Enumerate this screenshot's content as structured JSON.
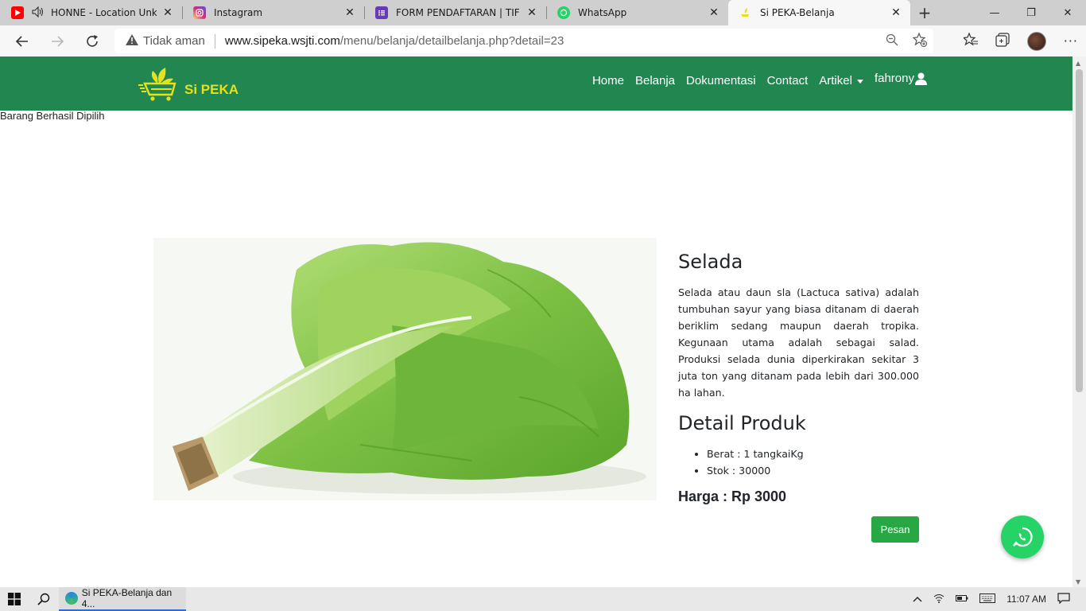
{
  "browser": {
    "tabs": [
      {
        "title": "HONNE - Location Unknown",
        "favicon": "youtube-icon",
        "favicon_color": "#ff0000",
        "has_audio": true
      },
      {
        "title": "Instagram",
        "favicon": "instagram-icon",
        "favicon_color": "#d62976"
      },
      {
        "title": "FORM PENDAFTARAN | TIF EXPO",
        "favicon": "forms-icon",
        "favicon_color": "#673ab7"
      },
      {
        "title": "WhatsApp",
        "favicon": "whatsapp-icon",
        "favicon_color": "#25d366"
      },
      {
        "title": "Si PEKA-Belanja",
        "favicon": "sipeka-icon",
        "favicon_color": "#e6e11b",
        "active": true
      }
    ],
    "security_label": "Tidak aman",
    "url_host": "www.sipeka.wsjti.com",
    "url_path": "/menu/belanja/detailbelanja.php?detail=23"
  },
  "site": {
    "brand_color": "#218650",
    "logo_text": "Si PEKA",
    "nav": {
      "home": "Home",
      "belanja": "Belanja",
      "dokumentasi": "Dokumentasi",
      "contact": "Contact",
      "artikel": "Artikel",
      "user": "fahrony"
    },
    "notice": "Barang Berhasil Dipilih"
  },
  "product": {
    "name": "Selada",
    "description": "Selada atau daun sla (Lactuca sativa) adalah tumbuhan sayur yang biasa ditanam di daerah beriklim sedang maupun daerah tropika. Kegunaan utama adalah sebagai salad. Produksi selada dunia diperkirakan sekitar 3 juta ton yang ditanam pada lebih dari 300.000 ha lahan.",
    "detail_heading": "Detail Produk",
    "details": {
      "berat": "Berat : 1 tangkaiKg",
      "stok": "Stok : 30000"
    },
    "price": "Harga : Rp 3000",
    "order_button": "Pesan"
  },
  "taskbar": {
    "app_label": "Si PEKA-Belanja dan 4...",
    "time": "11:07 AM"
  }
}
